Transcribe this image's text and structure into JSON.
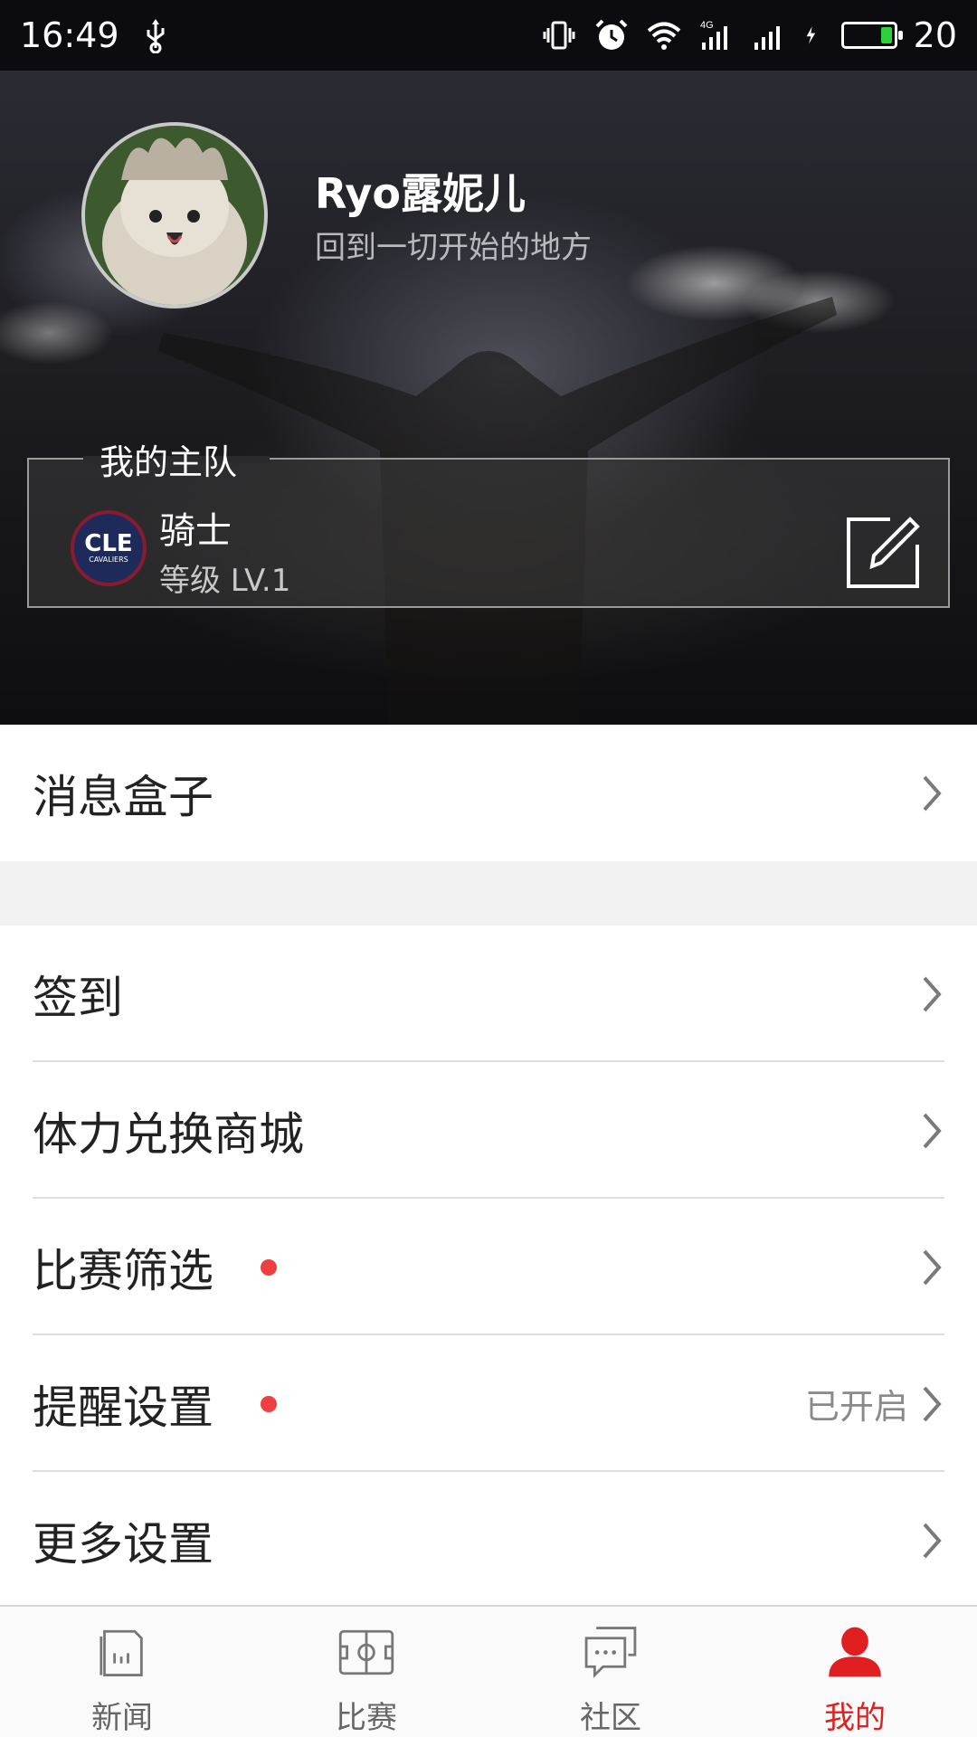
{
  "status_bar": {
    "time": "16:49",
    "battery_level": "20",
    "icons": [
      "usb-icon",
      "vibrate-icon",
      "alarm-icon",
      "wifi-icon",
      "signal-4g-icon",
      "signal-icon",
      "charging-icon",
      "battery-icon"
    ]
  },
  "profile": {
    "username": "Ryo露妮儿",
    "motto": "回到一切开始的地方"
  },
  "home_team": {
    "section_title": "我的主队",
    "logo_abbr": "CLE",
    "logo_sub": "CAVALIERS",
    "name": "骑士",
    "level": "等级 LV.1"
  },
  "menu": {
    "inbox": {
      "label": "消息盒子"
    },
    "checkin": {
      "label": "签到"
    },
    "stamina_shop": {
      "label": "体力兑换商城"
    },
    "match_filter": {
      "label": "比赛筛选"
    },
    "reminder_settings": {
      "label": "提醒设置",
      "value": "已开启"
    },
    "more_settings": {
      "label": "更多设置"
    }
  },
  "tabs": [
    {
      "label": "新闻",
      "icon": "news-icon"
    },
    {
      "label": "比赛",
      "icon": "match-icon"
    },
    {
      "label": "社区",
      "icon": "community-icon"
    },
    {
      "label": "我的",
      "icon": "profile-icon"
    }
  ],
  "colors": {
    "accent": "#e02020",
    "badge_dot": "#ee4040",
    "battery_fill": "#2fd13a"
  }
}
